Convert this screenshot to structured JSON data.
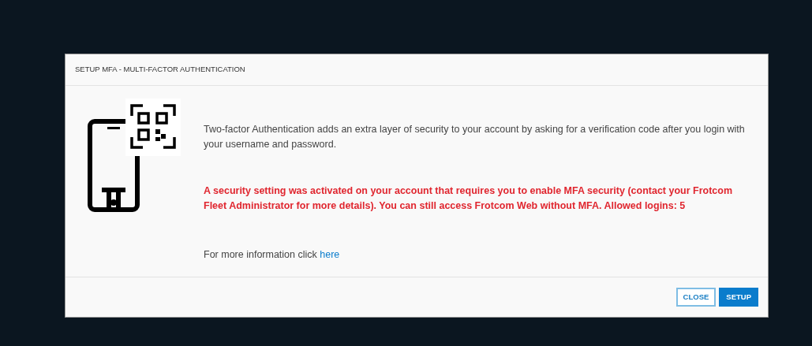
{
  "dialog": {
    "title": "SETUP MFA - MULTI-FACTOR AUTHENTICATION",
    "intro": "Two-factor Authentication adds an extra layer of security to your account by asking for a verification code after you login with your username and password.",
    "warning": "A security setting was activated on your account that requires you to enable MFA security (contact your Frotcom Fleet Administrator for more details). You can still access Frotcom Web without MFA. Allowed logins: 5",
    "more_info": {
      "text": "For more information click ",
      "link": "here"
    },
    "buttons": [
      {
        "label": "CLOSE",
        "kind": "outline"
      },
      {
        "label": "SETUP",
        "kind": "primary"
      }
    ]
  }
}
